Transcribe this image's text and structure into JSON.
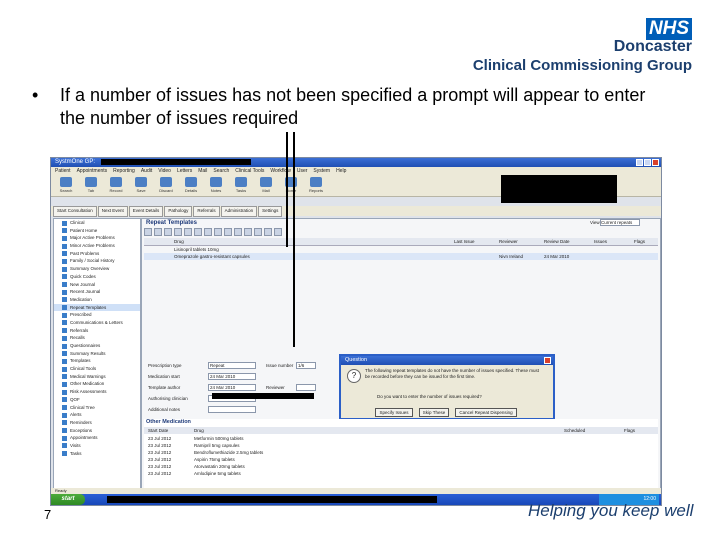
{
  "logo": {
    "nhs": "NHS",
    "line1": "Doncaster",
    "line2": "Clinical Commissioning Group"
  },
  "bullet": {
    "marker": "•",
    "text": "If a number of issues has not been specified a prompt will appear to enter the number of issues required"
  },
  "app": {
    "title": "SystmOne GP:",
    "menus": [
      "Patient",
      "Appointments",
      "Reporting",
      "Audit",
      "Video",
      "Letters",
      "Mail",
      "Search",
      "Clinical Tools",
      "Workflow",
      "User",
      "System",
      "Help"
    ],
    "toolbar": [
      "Search",
      "Tab",
      "Record",
      "Save",
      "Discard",
      "Details",
      "Notes",
      "Tasks",
      "Mail",
      "Home",
      "Reports"
    ],
    "tabs": [
      "Start Consultation",
      "Next Event",
      "Event Details",
      "Pathology",
      "Referrals",
      "Administration",
      "Settings"
    ],
    "left_panel": [
      "Clinical",
      "Patient Home",
      "Major Active Problems",
      "Minor Active Problems",
      "Past Problems",
      "Family / Social History",
      "Summary Overview",
      "Quick Codes",
      "New Journal",
      "Recent Journal",
      "Medication",
      "Repeat Templates",
      "Prescribed",
      "Communications & Letters",
      "Referrals",
      "Recalls",
      "Questionnaires",
      "Summary Results",
      "Templates",
      "Clinical Tools",
      "Medical Warnings",
      "Other Medication",
      "Risk Assessments",
      "QOF",
      "Clinical Tree",
      "Alerts",
      "Reminders",
      "Exceptions",
      "Appointments",
      "Visits",
      "Tasks"
    ],
    "main": {
      "title": "Repeat Templates",
      "view_label": "View",
      "view_value": "Current repeats",
      "columns": [
        "Drug",
        "Last Issue",
        "Reviewer",
        "Review Date",
        "Issues",
        "Flags"
      ],
      "rows": [
        [
          "Lisinopril tablets 10mg",
          "",
          "",
          "",
          "",
          ""
        ],
        [
          "Omeprazole gastro-resistant capsules",
          "",
          "Nivn Ireland",
          "24 Mar 2010",
          "",
          ""
        ]
      ]
    },
    "dialog": {
      "title": "Question",
      "message": "The following repeat templates do not have the number of issues specified. These must be recorded before they can be issued for the first time.",
      "question": "Do you want to enter the number of issues required?",
      "buttons": [
        "Specify Issues",
        "Skip These",
        "Cancel Repeat Dispensing"
      ]
    },
    "form": {
      "labels": [
        "Prescription type",
        "Medication start",
        "Template author",
        "Authorising clinician",
        "Additional notes",
        "Issue number",
        "Reviewer",
        "Repeat dispensing"
      ],
      "values": [
        "Repeat",
        "24 Mar 2010",
        "24 Mar 2010",
        "",
        "",
        "1/6",
        "",
        ""
      ]
    },
    "other_medication": {
      "title": "Other Medication",
      "columns": [
        "Start Date",
        "Drug",
        "Scheduled",
        "Flags"
      ],
      "rows": [
        [
          "23 Jul 2012",
          "Metformin 500mg tablets"
        ],
        [
          "23 Jul 2012",
          "Ramipril 5mg capsules"
        ],
        [
          "23 Jul 2012",
          "Bendroflumethiazide 2.5mg tablets"
        ],
        [
          "23 Jul 2012",
          "Aspirin 75mg tablets"
        ],
        [
          "23 Jul 2012",
          "Atorvastatin 20mg tablets"
        ],
        [
          "23 Jul 2012",
          "Amlodipine 5mg tablets"
        ]
      ]
    },
    "status": "Ready",
    "start_button": "start",
    "clock": "12:00"
  },
  "page_number": "7",
  "slogan": "Helping you keep well"
}
